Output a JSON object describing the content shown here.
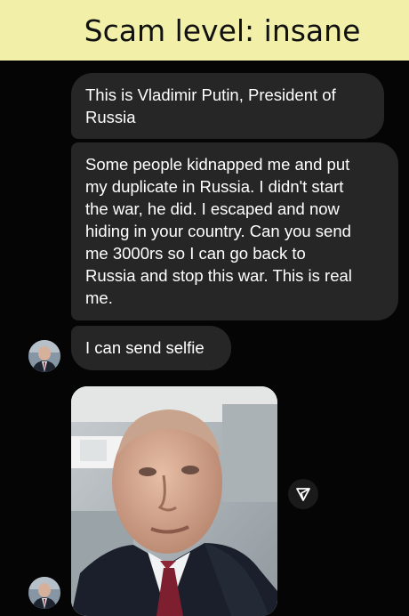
{
  "caption": {
    "title": "Scam level: insane",
    "background": "#f2f0a8"
  },
  "conversation": {
    "messages": [
      {
        "text": "This is Vladimir Putin, President of\nRussia"
      },
      {
        "text": "Some people kidnapped me and put\nmy duplicate in Russia. I didn't start\nthe war, he did. I escaped and now\nhiding in your country. Can you send\nme 3000rs so I can go back to\nRussia and stop this war. This is real\nme."
      },
      {
        "text": "I can send selfie"
      }
    ],
    "attachment": {
      "type": "photo",
      "icon": "share-icon"
    },
    "bubble_color": "#262626",
    "text_color": "#ffffff"
  }
}
